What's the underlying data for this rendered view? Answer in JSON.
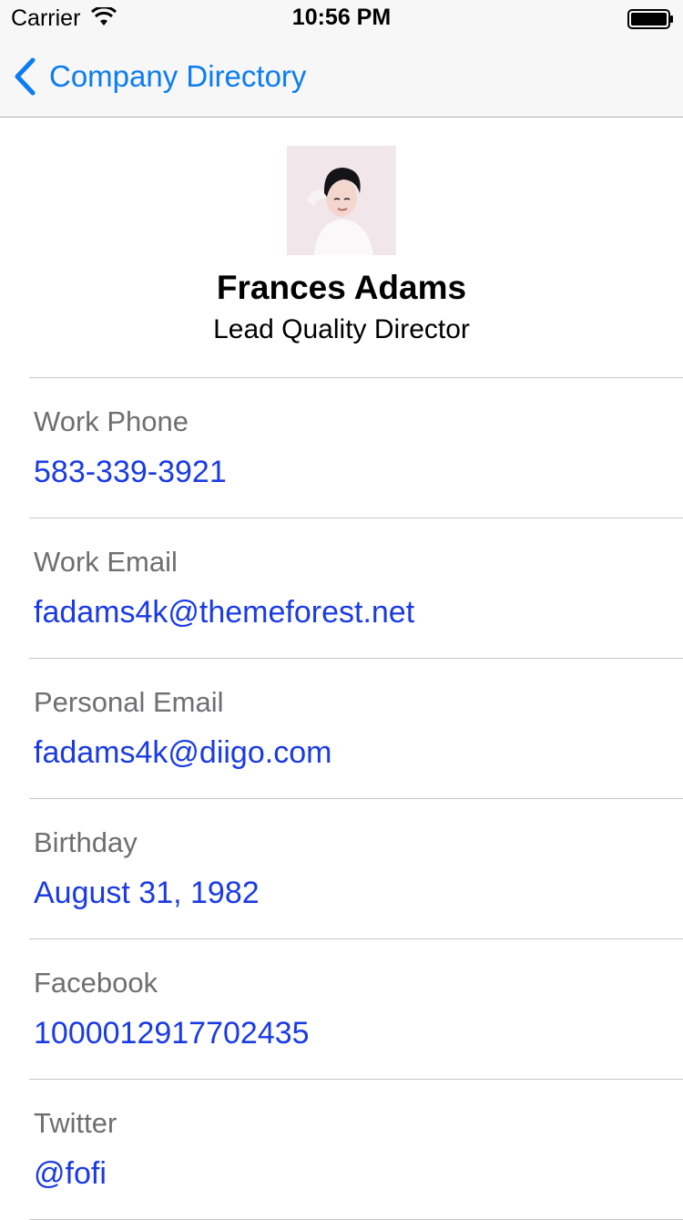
{
  "status_bar": {
    "carrier": "Carrier",
    "time": "10:56 PM",
    "icons": [
      "wifi-icon",
      "battery-icon"
    ]
  },
  "nav": {
    "back_label": "Company Directory",
    "back_icon": "chevron-left-icon",
    "accent_color": "#0b7cf3"
  },
  "profile": {
    "name": "Frances Adams",
    "title": "Lead Quality Director",
    "avatar": "person-photo"
  },
  "details": [
    {
      "label": "Work Phone",
      "value": "583-339-3921"
    },
    {
      "label": "Work Email",
      "value": "fadams4k@themeforest.net"
    },
    {
      "label": "Personal Email",
      "value": "fadams4k@diigo.com"
    },
    {
      "label": "Birthday",
      "value": "August 31, 1982"
    },
    {
      "label": "Facebook",
      "value": "1000012917702435"
    },
    {
      "label": "Twitter",
      "value": "@fofi"
    }
  ],
  "colors": {
    "link": "#1a3be3",
    "label": "#6e6e73",
    "separator": "#c8c7cc"
  }
}
